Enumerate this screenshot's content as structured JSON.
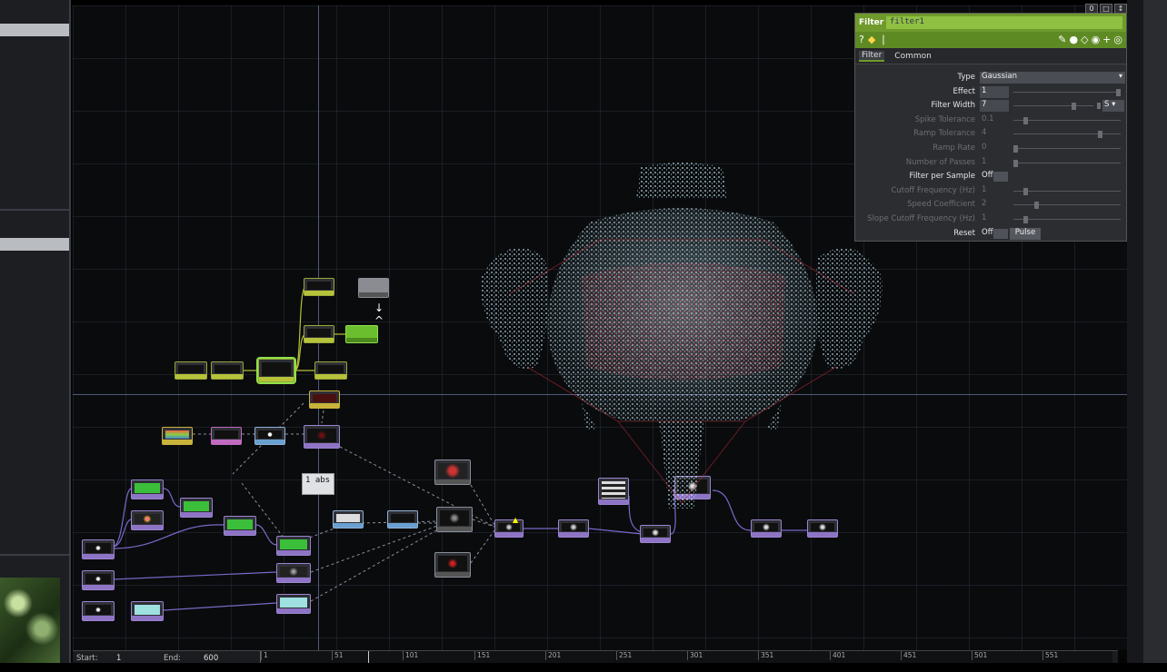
{
  "param_panel": {
    "op_type": "Filter",
    "op_name": "filter1",
    "tabs": [
      "Filter",
      "Common"
    ],
    "params": [
      {
        "label": "Type",
        "value": "Gaussian",
        "kind": "menu",
        "enabled": true
      },
      {
        "label": "Effect",
        "value": "1",
        "kind": "slider",
        "enabled": true,
        "fraction": 1.0
      },
      {
        "label": "Filter Width",
        "value": "7",
        "kind": "slider",
        "enabled": true,
        "unit": "S",
        "fraction": 0.77
      },
      {
        "label": "Spike Tolerance",
        "value": "0.1",
        "kind": "slider",
        "enabled": false,
        "fraction": 0.1
      },
      {
        "label": "Ramp Tolerance",
        "value": "4",
        "kind": "slider",
        "enabled": false,
        "fraction": 0.82
      },
      {
        "label": "Ramp Rate",
        "value": "0",
        "kind": "slider",
        "enabled": false,
        "fraction": 0.0
      },
      {
        "label": "Number of Passes",
        "value": "1",
        "kind": "slider",
        "enabled": false,
        "fraction": 0.0
      },
      {
        "label": "Filter per Sample",
        "value": "Off",
        "kind": "toggle",
        "enabled": true
      },
      {
        "label": "Cutoff Frequency (Hz)",
        "value": "1",
        "kind": "slider",
        "enabled": false,
        "fraction": 0.1
      },
      {
        "label": "Speed Coefficient",
        "value": "2",
        "kind": "slider",
        "enabled": false,
        "fraction": 0.2
      },
      {
        "label": "Slope Cutoff Frequency (Hz)",
        "value": "1",
        "kind": "slider",
        "enabled": false,
        "fraction": 0.1
      },
      {
        "label": "Reset",
        "value": "Off",
        "kind": "pulse",
        "enabled": true,
        "button": "Pulse"
      }
    ],
    "toolbar_icons": [
      "help-icon",
      "python-icon",
      "pencil-icon",
      "comment-icon",
      "eraser-icon",
      "viewer-icon",
      "add-icon",
      "target-icon"
    ]
  },
  "window_buttons": [
    "0",
    "□",
    "↕"
  ],
  "network": {
    "abs_node_text": "1 abs",
    "colors": {
      "chop": "#b6c23a",
      "top": "#8e74c4",
      "selected": "#8fe04a",
      "wire": "#7a68c8"
    }
  },
  "timeline": {
    "start_label": "Start:",
    "start_value": "1",
    "end_label": "End:",
    "end_value": "600",
    "ticks": [
      "1",
      "51",
      "101",
      "151",
      "201",
      "251",
      "301",
      "351",
      "401",
      "451",
      "501",
      "551"
    ]
  }
}
